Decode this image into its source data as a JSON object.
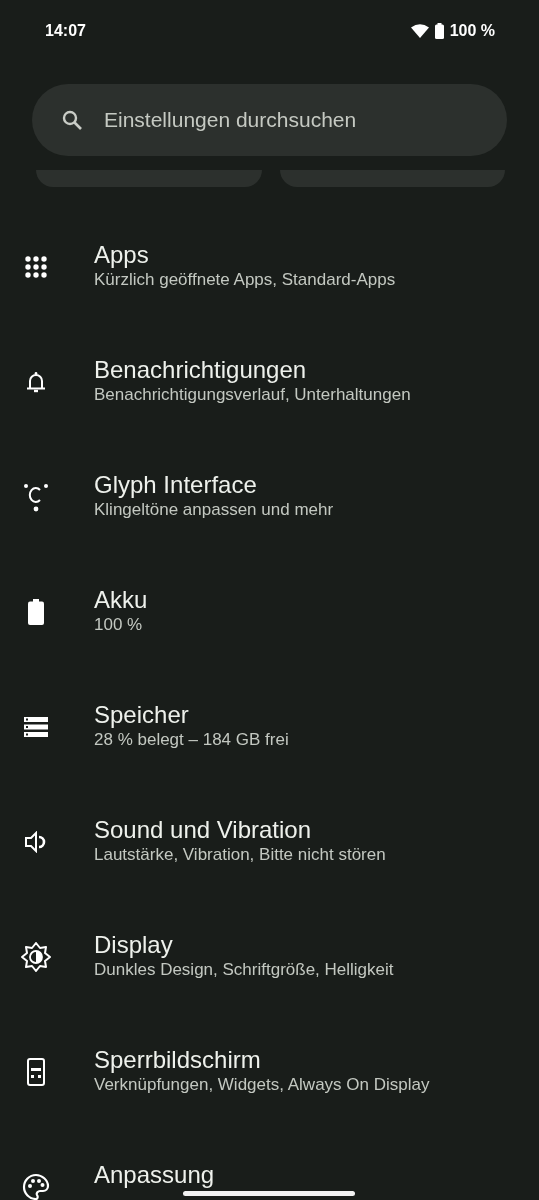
{
  "status_bar": {
    "time": "14:07",
    "battery": "100 %"
  },
  "search": {
    "placeholder": "Einstellungen durchsuchen"
  },
  "suggestion_cards": [
    {
      "kind": "card"
    },
    {
      "kind": "card"
    }
  ],
  "items": [
    {
      "kind": "apps",
      "title": "Apps",
      "subtitle": "Kürzlich geöffnete Apps, Standard-Apps"
    },
    {
      "kind": "bell",
      "title": "Benachrichtigungen",
      "subtitle": "Benachrichtigungsverlauf, Unterhaltungen"
    },
    {
      "kind": "glyph",
      "title": "Glyph Interface",
      "subtitle": "Klingeltöne anpassen und mehr"
    },
    {
      "kind": "battery",
      "title": "Akku",
      "subtitle": "100 %"
    },
    {
      "kind": "storage",
      "title": "Speicher",
      "subtitle": "28 % belegt – 184 GB frei"
    },
    {
      "kind": "sound",
      "title": "Sound und Vibration",
      "subtitle": "Lautstärke, Vibration, Bitte nicht stören"
    },
    {
      "kind": "display",
      "title": "Display",
      "subtitle": "Dunkles Design, Schriftgröße, Helligkeit"
    },
    {
      "kind": "lock",
      "title": "Sperrbildschirm",
      "subtitle": "Verknüpfungen, Widgets, Always On Display"
    },
    {
      "kind": "palette",
      "title": "Anpassung"
    }
  ]
}
